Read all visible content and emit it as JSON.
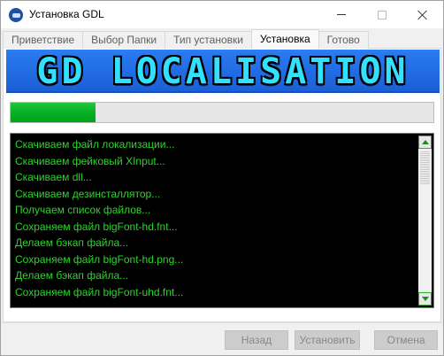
{
  "window": {
    "title": "Установка GDL",
    "icon": "gdl-app-icon"
  },
  "tabs": [
    {
      "label": "Приветствие",
      "active": false
    },
    {
      "label": "Выбор Папки",
      "active": false
    },
    {
      "label": "Тип установки",
      "active": false
    },
    {
      "label": "Установка",
      "active": true
    },
    {
      "label": "Готово",
      "active": false
    }
  ],
  "banner": {
    "text": "GD LOCALISATION"
  },
  "progress": {
    "value_percent": 20,
    "color": "#06b025"
  },
  "log": {
    "text_color": "#29d629",
    "lines": [
      "Скачиваем файл локализации...",
      "Скачиваем фейковый XInput...",
      "Скачиваем dll...",
      "Скачиваем дезинсталлятор...",
      "Получаем список файлов...",
      "Сохраняем файл bigFont-hd.fnt...",
      "Делаем бэкап файла...",
      "Сохраняем файл bigFont-hd.png...",
      "Делаем бэкап файла...",
      "Сохраняем файл bigFont-uhd.fnt..."
    ]
  },
  "footer": {
    "back_label": "Назад",
    "install_label": "Установить",
    "cancel_label": "Отмена"
  }
}
